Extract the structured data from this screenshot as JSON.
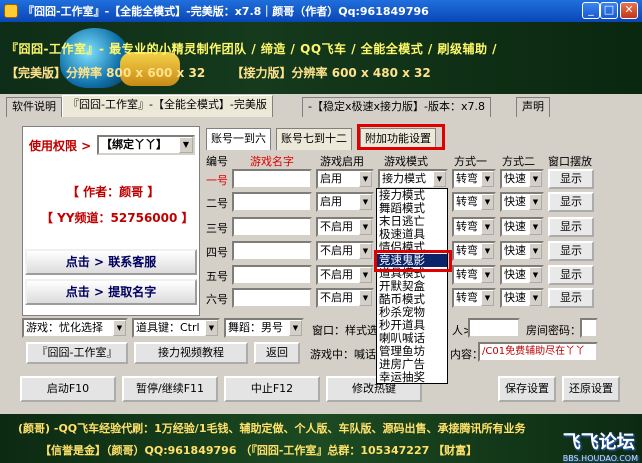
{
  "window": {
    "title": "『囧囧-工作室』-【全能全模式】-完美版：x7.8｜颜哥（作者）Qq:961849796",
    "min": "_",
    "max": "□",
    "close": "✕"
  },
  "banner": {
    "line1": "『囧囧-工作室』-  最专业的小精灵制作团队 / 缔造 / QQ飞车 / 全能全模式 / 刷级辅助 /",
    "line2a": "【完美版】分辨率 800 x 600 x 32",
    "line2b": "【接力版】分辨率 600 x 480 x 32"
  },
  "top_tabs": [
    {
      "label": "软件说明"
    },
    {
      "label": "『囧囧-工作室』-【全能全模式】-完美版"
    },
    {
      "label": "-【稳定x极速x接力版】-版本：x7.8"
    },
    {
      "label": "声明"
    }
  ],
  "left": {
    "perm_label": "使用权限 >",
    "perm_value": "【绑定丫丫】",
    "author": "【 作者：颜哥 】",
    "yy": "【 YY频道：52756000 】",
    "contact_btn": "点击 > 联系客服",
    "name_btn": "点击 > 提取名字"
  },
  "inner_tabs": [
    "账号一到六",
    "账号七到十二",
    "附加功能设置"
  ],
  "headers": {
    "num": "编号",
    "name": "游戏名字",
    "enable": "游戏启用",
    "mode": "游戏模式",
    "way1": "方式一",
    "way2": "方式二",
    "window": "窗口摆放"
  },
  "rows": [
    {
      "label": "一号",
      "enable": "启用",
      "mode": "接力模式",
      "way1": "转弯",
      "way2": "快速",
      "show": "显示"
    },
    {
      "label": "二号",
      "enable": "启用",
      "mode": "",
      "way1": "转弯",
      "way2": "快速",
      "show": "显示"
    },
    {
      "label": "三号",
      "enable": "不启用",
      "mode": "",
      "way1": "转弯",
      "way2": "快速",
      "show": "显示"
    },
    {
      "label": "四号",
      "enable": "不启用",
      "mode": "",
      "way1": "转弯",
      "way2": "快速",
      "show": "显示"
    },
    {
      "label": "五号",
      "enable": "不启用",
      "mode": "",
      "way1": "转弯",
      "way2": "快速",
      "show": "显示"
    },
    {
      "label": "六号",
      "enable": "不启用",
      "mode": "",
      "way1": "转弯",
      "way2": "快速",
      "show": "显示"
    }
  ],
  "dropdown_items": [
    "接力模式",
    "舞蹈模式",
    "末日逃亡",
    "极速道具",
    "情侣模式",
    "竞速鬼影",
    "道具模式",
    "开默契盒",
    "酷币模式",
    "秒杀宠物",
    "秒开道具",
    "喇叭喊话",
    "管理鱼坊",
    "进房广告",
    "幸运抽奖"
  ],
  "dropdown_selected": 5,
  "bottom": {
    "game_label": "游戏：忧化选择",
    "prop_key": "道具键：Ctrl",
    "dance": "舞蹈：男号",
    "window_label": "窗口：样式选",
    "person_label": "人>",
    "room_pwd": "房间密码：",
    "studio_btn": "『囧囧-工作室』",
    "video_btn": "接力视频教程",
    "back_btn": "返回",
    "game_in": "游戏中：喊话",
    "content_label": "内容：",
    "content_value": "/C01免费辅助尽在丫丫"
  },
  "actions": {
    "start": "启动F10",
    "pause": "暂停/继续F11",
    "stop": "中止F12",
    "hotkey": "修改热键",
    "save": "保存设置",
    "restore": "还原设置"
  },
  "footer": {
    "f1": "(颜哥) -QQ飞车经验代刷：1万经验/1毛钱、辅助定做、个人版、车队版、源码出售、承接腾讯所有业务",
    "f2": "【信誉是金】（颜哥）QQ:961849796    （『囧囧-工作室』总群：105347227    【财富】",
    "wm": "飞飞论坛",
    "wm_sub": "BBS.HOUDAO.COM"
  }
}
